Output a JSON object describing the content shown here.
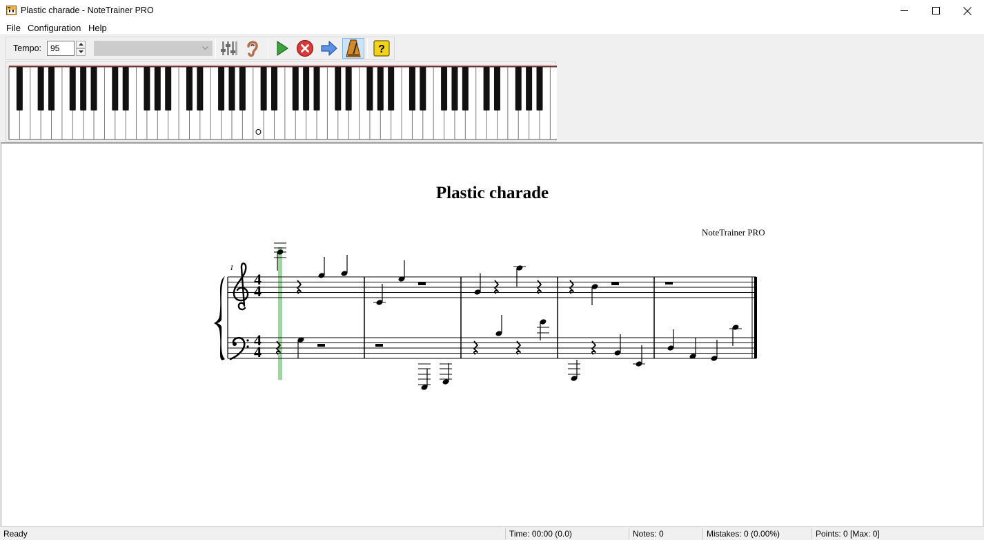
{
  "window": {
    "title": "Plastic charade - NoteTrainer PRO"
  },
  "menu": {
    "file": "File",
    "configuration": "Configuration",
    "help": "Help"
  },
  "toolbar": {
    "tempo_label": "Tempo:",
    "tempo_value": "95",
    "instrument_value": "",
    "buttons": {
      "mixer": "mixer-icon",
      "ear": "ear-icon",
      "play": "play-icon",
      "stop": "stop-icon",
      "next": "arrow-right-icon",
      "metronome": "metronome-icon",
      "help": "help-icon"
    },
    "metronome_active": true
  },
  "keyboard": {
    "white_keys": 52,
    "marker_label": "o"
  },
  "score": {
    "title": "Plastic charade",
    "composer": "NoteTrainer PRO",
    "measure_number": "1",
    "time_signature_top": "4",
    "time_signature_bottom": "4",
    "measures": 5,
    "cursor_color": "#8fce8f"
  },
  "status": {
    "ready": "Ready",
    "time": "Time: 00:00 (0.0)",
    "notes": "Notes: 0",
    "mistakes": "Mistakes: 0 (0.00%)",
    "points": "Points: 0 [Max: 0]"
  }
}
